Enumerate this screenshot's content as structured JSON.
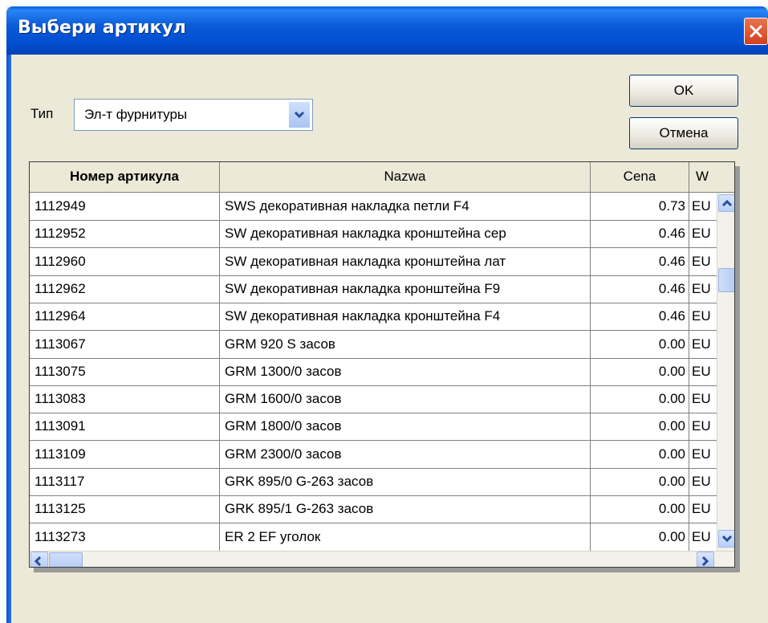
{
  "window": {
    "title": "Выбери артикул"
  },
  "filter": {
    "label": "Тип",
    "selected": "Эл-т фурнитуры"
  },
  "buttons": {
    "ok": "OK",
    "cancel": "Отмена"
  },
  "table": {
    "headers": [
      "Номер артикула",
      "Nazwa",
      "Cena",
      "W"
    ],
    "rows": [
      [
        "1112949",
        "SWS декоративная накладка петли F4",
        "0.73",
        "EU"
      ],
      [
        "1112952",
        "SW декоративная накладка кронштейна сер",
        "0.46",
        "EU"
      ],
      [
        "1112960",
        "SW декоративная накладка кронштейна лат",
        "0.46",
        "EU"
      ],
      [
        "1112962",
        "SW декоративная накладка кронштейна F9",
        "0.46",
        "EU"
      ],
      [
        "1112964",
        "SW декоративная накладка кронштейна F4",
        "0.46",
        "EU"
      ],
      [
        "1113067",
        "GRM 920 S засов",
        "0.00",
        "EU"
      ],
      [
        "1113075",
        "GRM 1300/0 засов",
        "0.00",
        "EU"
      ],
      [
        "1113083",
        "GRM 1600/0 засов",
        "0.00",
        "EU"
      ],
      [
        "1113091",
        "GRM 1800/0 засов",
        "0.00",
        "EU"
      ],
      [
        "1113109",
        "GRM 2300/0 засов",
        "0.00",
        "EU"
      ],
      [
        "1113117",
        "GRK 895/0 G-263 засов",
        "0.00",
        "EU"
      ],
      [
        "1113125",
        "GRK 895/1 G-263 засов",
        "0.00",
        "EU"
      ],
      [
        "1113273",
        "ER 2 EF уголок",
        "0.00",
        "EU"
      ]
    ]
  },
  "icons": {
    "close": "close-icon",
    "dropdown": "chevron-down-icon",
    "scroll_up": "arrow-up-icon",
    "scroll_down": "arrow-down-icon",
    "scroll_left": "arrow-left-icon",
    "scroll_right": "arrow-right-icon"
  },
  "colors": {
    "titlebar": "#0351d3",
    "dialog_bg": "#ece9d8",
    "close_button": "#d2411f"
  }
}
